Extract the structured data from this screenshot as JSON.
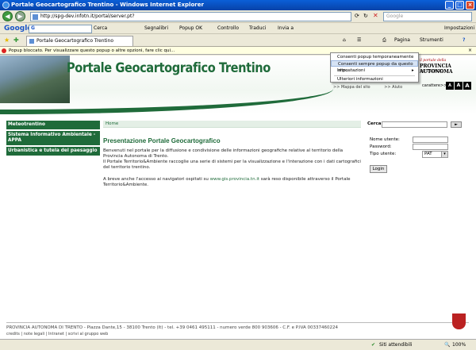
{
  "window": {
    "title": "Portale Geocartografico Trentino - Windows Internet Explorer",
    "min": "_",
    "max": "□",
    "close": "×"
  },
  "address": {
    "url": "http://spg-dev.infotn.it/portal/server.pt?",
    "search_placeholder": "Google"
  },
  "google_toolbar": {
    "logo": "Google",
    "g_label": "G",
    "cerca": "Cerca",
    "segnalibri": "Segnalibri",
    "popup": "Popup OK",
    "controllo": "Controllo",
    "traduci": "Traduci",
    "invia": "Invia a",
    "impostazioni": "Impostazioni"
  },
  "tabbar": {
    "tab_title": "Portale Geocartografico Trentino",
    "pagina": "Pagina",
    "strumenti": "Strumenti"
  },
  "infobar": {
    "text": "Popup bloccato. Per visualizzare questo popup o altre opzioni, fare clic qui..."
  },
  "popup_menu": {
    "items": [
      "Consenti popup temporaneamente",
      "Consenti sempre popup da questo sito...",
      "Impostazioni",
      "Ulteriori informazioni"
    ],
    "submenu_arrow": "▸"
  },
  "banner": {
    "title": "Portale Geocartografico Trentino",
    "logo_line1": "il portale della",
    "logo_line2": "PROVINCIA AUTONOMA",
    "logo_line3": "DI TRENTO",
    "mappa": ">> Mappa del sito",
    "aiuto": ">> Aiuto",
    "carattere": "carattere>>",
    "char_buttons": [
      "A",
      "A",
      "A"
    ]
  },
  "sidebar": {
    "items": [
      "Meteotrentino",
      "Sistema Informativo Ambientale - APPA",
      "Urbanistica e tutela del paesaggio"
    ]
  },
  "main": {
    "breadcrumb": "Home",
    "heading": "Presentazione Portale Geocartografico",
    "p1": "Benvenuti nel portale per la diffusione e condivisione delle informazioni geografiche relative al territorio della Provincia Autonoma di Trento.",
    "p2": "Il Portale Territorio&Ambiente raccoglie una serie di sistemi per la visualizzazione e l'interazione con i dati cartografici del territorio trentino.",
    "p3a": "A breve anche l'accesso ai navigatori ospitati su ",
    "p3link": "www.gis.provincia.tn.it",
    "p3b": " sarà reso disponibile attraverso il Portale Territorio&Ambiente."
  },
  "login": {
    "cerca_label": "Cerca:",
    "go": "►",
    "user_label": "Nome utente:",
    "pass_label": "Password:",
    "tipo_label": "Tipo utente:",
    "tipo_value": "PAT",
    "tipo_arrow": "▾",
    "button": "Login"
  },
  "footer": {
    "line1": "PROVINCIA AUTONOMA DI TRENTO - Piazza Dante,15 - 38100 Trento (It) - tel. +39 0461 495111 - numero verde 800 903606 - C.F. e P.IVA 00337460224",
    "line2": "credits | note legali | Intranet | scrivi al gruppo web"
  },
  "status": {
    "zone": "Siti attendibili",
    "zoom": "100%"
  }
}
